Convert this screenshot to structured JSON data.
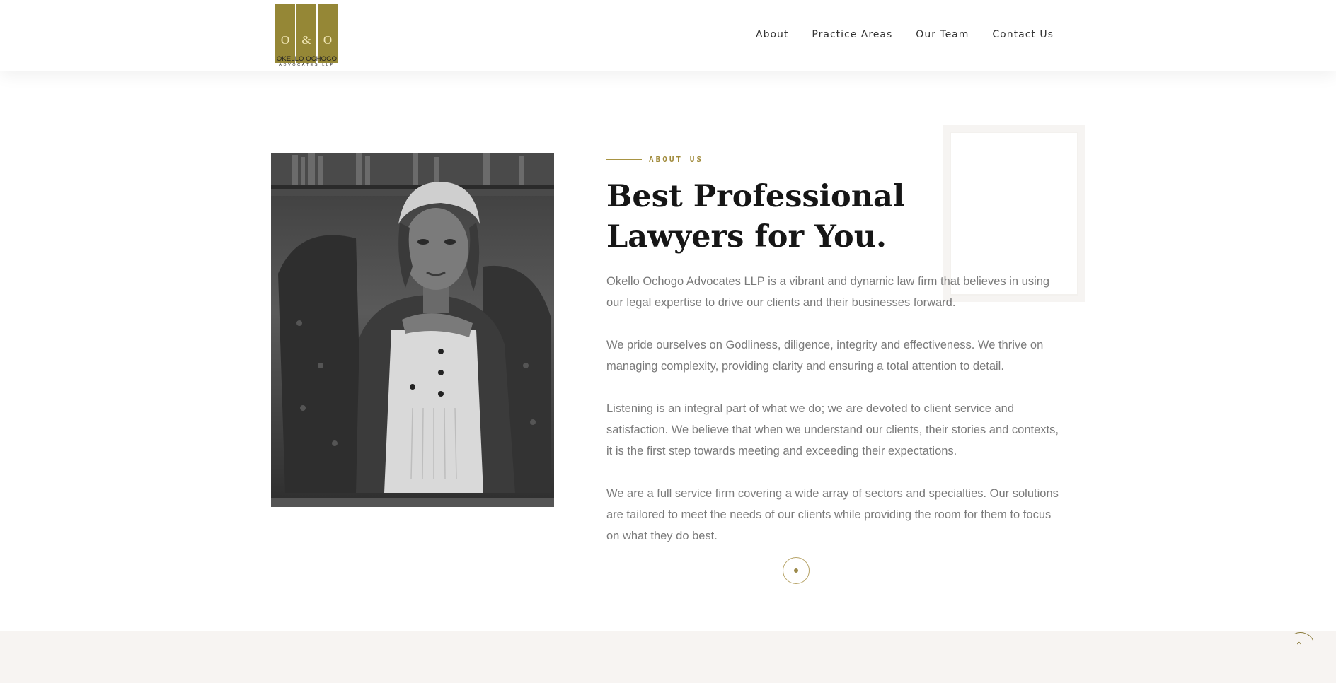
{
  "header": {
    "logo": {
      "letters": [
        "O",
        "&",
        "O"
      ],
      "name": "OKELLO OCHOGO",
      "subtitle": "ADVOCATES LLP",
      "bar_color": "#958736"
    },
    "nav": [
      {
        "label": "About"
      },
      {
        "label": "Practice Areas"
      },
      {
        "label": "Our Team"
      },
      {
        "label": "Contact Us"
      }
    ]
  },
  "about": {
    "eyebrow": "ABOUT US",
    "headline_line1": "Best Professional",
    "headline_line2": "Lawyers for You.",
    "paragraphs": [
      "Okello Ochogo Advocates LLP is a vibrant and dynamic law firm that believes in using our legal expertise to drive our clients and their businesses forward.",
      "We pride ourselves on Godliness, diligence, integrity and effectiveness. We thrive on managing complexity, providing clarity and ensuring a total attention to detail.",
      "Listening is an integral part of what we do; we are devoted to client service and satisfaction. We believe that when we understand our clients, their stories and contexts, it is the first step towards meeting and exceeding their expectations.",
      "We are a full service firm covering a wide array of sectors and specialties. Our solutions are tailored to meet the needs of our clients while providing the room for them to focus on what they do best."
    ],
    "image_icon": "lawyer-portrait-photo"
  },
  "controls": {
    "scroll_top_icon": "chevron-up-icon",
    "scroll_top_glyph": "⌃",
    "slider_dot_icon": "dot-icon"
  },
  "colors": {
    "accent": "#a08a3a",
    "band": "#f7f4f2",
    "heading": "#161616",
    "body_text": "#7a7a7a"
  }
}
